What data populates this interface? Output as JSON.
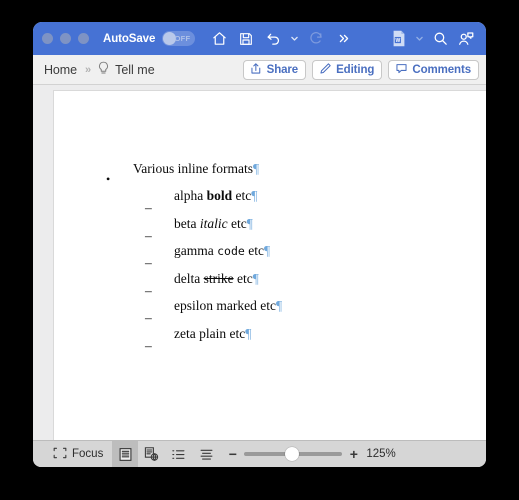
{
  "window": {
    "titlebar": {
      "autosave_label": "AutoSave",
      "autosave_state": "OFF",
      "traffic_lights": [
        "close-button",
        "minimize-button",
        "maximize-button"
      ],
      "icons": [
        {
          "name": "home-icon",
          "label": "Home"
        },
        {
          "name": "save-icon",
          "label": "Save"
        },
        {
          "name": "undo-icon",
          "label": "Undo"
        },
        {
          "name": "undo-dropdown-chevron-icon",
          "label": "Undo options"
        },
        {
          "name": "redo-icon",
          "label": "Redo"
        },
        {
          "name": "overflow-chevrons-icon",
          "label": "More"
        },
        {
          "name": "word-document-icon",
          "label": "Document"
        },
        {
          "name": "document-dropdown-chevron-icon",
          "label": "Document options"
        },
        {
          "name": "search-icon",
          "label": "Search"
        },
        {
          "name": "collaboration-icon",
          "label": "Collaborate"
        }
      ]
    },
    "ribbon": {
      "home_tab": "Home",
      "expand_chevron": "»",
      "tell_me": "Tell me",
      "share_label": "Share",
      "editing_label": "Editing",
      "comments_label": "Comments"
    },
    "statusbar": {
      "focus_label": "Focus",
      "zoom_minus": "−",
      "zoom_plus": "+",
      "zoom_level": "125%",
      "zoom_slider_percent": 49,
      "buttons": [
        {
          "name": "print-layout-view-button",
          "active": true
        },
        {
          "name": "web-layout-view-button",
          "active": false
        },
        {
          "name": "outline-view-button",
          "active": false
        },
        {
          "name": "draft-view-button",
          "active": false
        }
      ]
    }
  },
  "document": {
    "paragraphs": [
      {
        "level": 1,
        "marker": "•",
        "runs": [
          {
            "text": "Various inline formats",
            "style": "plain"
          },
          {
            "text": "¶",
            "style": "pilcrow"
          }
        ]
      },
      {
        "level": 2,
        "marker": "–",
        "runs": [
          {
            "text": "alpha ",
            "style": "plain"
          },
          {
            "text": "bold",
            "style": "bold"
          },
          {
            "text": " etc",
            "style": "plain"
          },
          {
            "text": "¶",
            "style": "pilcrow"
          }
        ]
      },
      {
        "level": 2,
        "marker": "–",
        "runs": [
          {
            "text": "beta ",
            "style": "plain"
          },
          {
            "text": "italic",
            "style": "italic"
          },
          {
            "text": " etc",
            "style": "plain"
          },
          {
            "text": "¶",
            "style": "pilcrow"
          }
        ]
      },
      {
        "level": 2,
        "marker": "–",
        "runs": [
          {
            "text": "gamma ",
            "style": "plain"
          },
          {
            "text": "code",
            "style": "code"
          },
          {
            "text": " etc",
            "style": "plain"
          },
          {
            "text": "¶",
            "style": "pilcrow"
          }
        ]
      },
      {
        "level": 2,
        "marker": "–",
        "runs": [
          {
            "text": "delta ",
            "style": "plain"
          },
          {
            "text": "strike",
            "style": "strike"
          },
          {
            "text": " etc",
            "style": "plain"
          },
          {
            "text": "¶",
            "style": "pilcrow"
          }
        ]
      },
      {
        "level": 2,
        "marker": "–",
        "runs": [
          {
            "text": "epsilon ",
            "style": "plain"
          },
          {
            "text": "marked",
            "style": "marked"
          },
          {
            "text": " etc",
            "style": "plain"
          },
          {
            "text": "¶",
            "style": "pilcrow"
          }
        ]
      },
      {
        "level": 2,
        "marker": "–",
        "runs": [
          {
            "text": "zeta plain etc",
            "style": "plain"
          },
          {
            "text": "¶",
            "style": "pilcrow"
          }
        ]
      }
    ]
  },
  "colors": {
    "titlebar_blue": "#4672d4",
    "accent_blue": "#4a6fc0",
    "pilcrow_blue": "#6fa8dc",
    "statusbar_grey": "#d6d6d6",
    "desktop": "#000000"
  }
}
